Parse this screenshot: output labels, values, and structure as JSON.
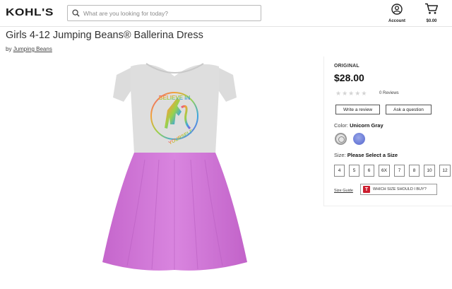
{
  "header": {
    "logo": "KOHL'S",
    "search_placeholder": "What are you looking for today?",
    "account_label": "Account",
    "cart_label": "$0.00"
  },
  "product": {
    "title": "Girls 4-12 Jumping Beans® Ballerina Dress",
    "by_prefix": "by",
    "brand": "Jumping Beans",
    "graphic_text_top": "BELIEVE IN",
    "graphic_text_bottom": "YOURSELF",
    "colors": {
      "bodice": "#dedede",
      "skirt": "#d174d8",
      "skirt_shade": "#b95fc2"
    }
  },
  "panel": {
    "original_label": "ORIGINAL",
    "price": "$28.00",
    "rating": 0,
    "reviews": "0 Reviews",
    "write_review": "Write a review",
    "ask_question": "Ask a question",
    "color_label": "Color:",
    "color_value": "Unicorn Gray",
    "size_label": "Size:",
    "size_value": "Please Select a Size",
    "sizes": [
      "4",
      "5",
      "6",
      "6X",
      "7",
      "8",
      "10",
      "12"
    ],
    "size_guide": "Size Guide",
    "which_size": "WHICH SIZE SHOULD I BUY?",
    "which_size_badge": "T"
  }
}
